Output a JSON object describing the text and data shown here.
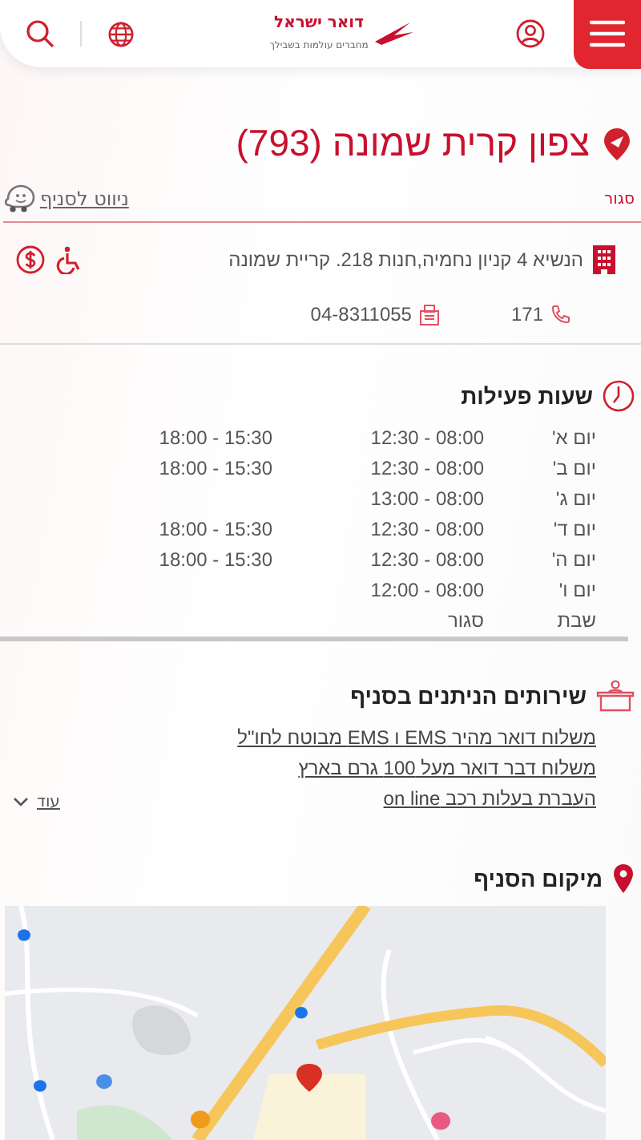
{
  "header": {
    "logo_line1": "דואר",
    "logo_line2": "ישראל",
    "tagline": "מחברים עולמות בשבילך"
  },
  "branch": {
    "title": "צפון קרית שמונה (793)",
    "status": "סגור",
    "navigate_link": "ניווט לסניף",
    "address": "הנשיא 4 קניון נחמיה,חנות 218. קריית שמונה",
    "phone": "171",
    "fax": "04-8311055"
  },
  "hours": {
    "title": "שעות פעילות",
    "rows": [
      {
        "day": "יום א'",
        "morning": "08:00 - 12:30",
        "evening": "15:30 - 18:00"
      },
      {
        "day": "יום ב'",
        "morning": "08:00 - 12:30",
        "evening": "15:30 - 18:00"
      },
      {
        "day": "יום ג'",
        "morning": "08:00 - 13:00"
      },
      {
        "day": "יום ד'",
        "morning": "08:00 - 12:30",
        "evening": "15:30 - 18:00"
      },
      {
        "day": "יום ה'",
        "morning": "08:00 - 12:30",
        "evening": "15:30 - 18:00"
      },
      {
        "day": "יום ו'",
        "morning": "08:00 - 12:00"
      },
      {
        "day": "שבת",
        "morning": "סגור"
      }
    ]
  },
  "services": {
    "title": "שירותים הניתנים בסניף",
    "items": [
      "משלוח דואר מהיר EMS ו EMS מבוטח לחו\"ל",
      "משלוח דבר דואר מעל 100 גרם בארץ",
      "העברת בעלות רכב on line"
    ],
    "more_label": "עוד"
  },
  "location": {
    "title": "מיקום הסניף"
  }
}
